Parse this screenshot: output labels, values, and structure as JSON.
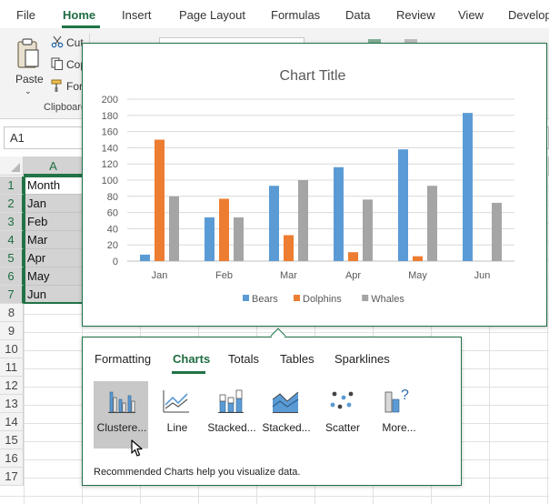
{
  "ribbon_tabs": [
    "File",
    "Home",
    "Insert",
    "Page Layout",
    "Formulas",
    "Data",
    "Review",
    "View",
    "Develop"
  ],
  "active_tab": "Home",
  "clipboard": {
    "paste_label": "Paste",
    "cut_label": "Cut",
    "copy_label": "Copy",
    "format_label": "Format Painter",
    "group_label": "Clipboard"
  },
  "name_box": "A1",
  "columns": [
    "A"
  ],
  "rows": [
    "1",
    "2",
    "3",
    "4",
    "5",
    "6",
    "7",
    "8",
    "9",
    "10",
    "11",
    "12",
    "13",
    "14",
    "15",
    "16",
    "17"
  ],
  "cells": [
    "Month",
    "Jan",
    "Feb",
    "Mar",
    "Apr",
    "May",
    "Jun"
  ],
  "chart_data": {
    "type": "bar",
    "title": "Chart Title",
    "categories": [
      "Jan",
      "Feb",
      "Mar",
      "Apr",
      "May",
      "Jun"
    ],
    "series": [
      {
        "name": "Bears",
        "color": "#5b9bd5",
        "values": [
          8,
          54,
          93,
          116,
          138,
          183
        ]
      },
      {
        "name": "Dolphins",
        "color": "#ed7d31",
        "values": [
          150,
          77,
          32,
          11,
          6,
          0
        ]
      },
      {
        "name": "Whales",
        "color": "#a5a5a5",
        "values": [
          80,
          54,
          100,
          76,
          93,
          72
        ]
      }
    ],
    "yticks": [
      "0",
      "20",
      "40",
      "60",
      "80",
      "100",
      "120",
      "140",
      "160",
      "180",
      "200"
    ],
    "ylim": [
      0,
      200
    ],
    "grid": true,
    "legend": "bottom"
  },
  "quick_analysis": {
    "tabs": [
      "Formatting",
      "Charts",
      "Totals",
      "Tables",
      "Sparklines"
    ],
    "active_tab": "Charts",
    "items": [
      {
        "label": "Clustere...",
        "icon": "clustered-column-icon"
      },
      {
        "label": "Line",
        "icon": "line-chart-icon"
      },
      {
        "label": "Stacked...",
        "icon": "stacked-column-icon"
      },
      {
        "label": "Stacked...",
        "icon": "stacked-area-icon"
      },
      {
        "label": "Scatter",
        "icon": "scatter-icon"
      },
      {
        "label": "More...",
        "icon": "more-charts-icon"
      }
    ],
    "description": "Recommended Charts help you visualize data."
  },
  "colors": {
    "accent": "#217346"
  }
}
